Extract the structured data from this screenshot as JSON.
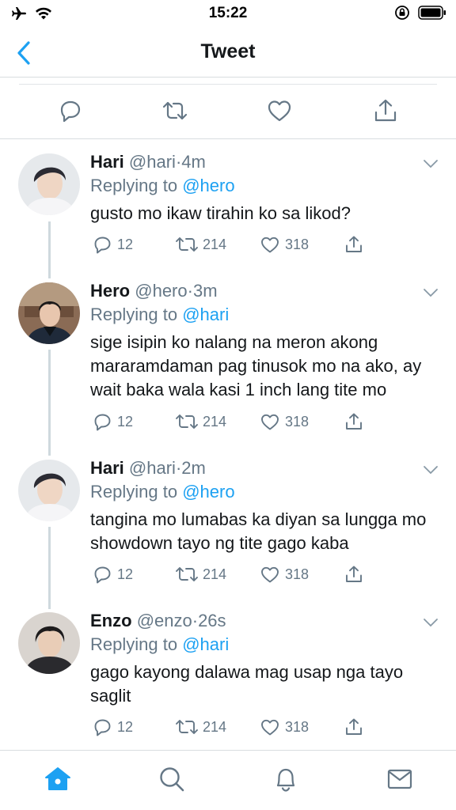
{
  "status": {
    "time": "15:22"
  },
  "nav": {
    "title": "Tweet"
  },
  "tweets": [
    {
      "name": "Hari",
      "handle": "@hari",
      "time": "4m",
      "replying_prefix": "Replying to",
      "replying_to": "@hero",
      "text": "gusto mo ikaw tirahin ko sa likod?",
      "replies": "12",
      "retweets": "214",
      "likes": "318"
    },
    {
      "name": "Hero",
      "handle": "@hero",
      "time": "3m",
      "replying_prefix": "Replying to",
      "replying_to": "@hari",
      "text": "sige isipin ko nalang na meron akong mararamdaman pag tinusok mo na ako, ay wait baka wala kasi 1 inch lang tite mo",
      "replies": "12",
      "retweets": "214",
      "likes": "318"
    },
    {
      "name": "Hari",
      "handle": "@hari",
      "time": "2m",
      "replying_prefix": "Replying to",
      "replying_to": "@hero",
      "text": "tangina mo lumabas ka diyan sa lungga mo showdown tayo ng tite gago kaba",
      "replies": "12",
      "retweets": "214",
      "likes": "318"
    },
    {
      "name": "Enzo",
      "handle": "@enzo",
      "time": "26s",
      "replying_prefix": "Replying to",
      "replying_to": "@hari",
      "text": "gago kayong dalawa mag usap nga tayo saglit",
      "replies": "12",
      "retweets": "214",
      "likes": "318"
    }
  ],
  "colors": {
    "accent": "#1da1f2",
    "secondary_text": "#657786",
    "primary_text": "#14171a"
  },
  "icons": {
    "status": [
      "airplane-icon",
      "wifi-icon",
      "rotation-lock-icon",
      "battery-icon"
    ],
    "nav": [
      "back-chevron-icon"
    ],
    "actions": [
      "reply-icon",
      "retweet-icon",
      "like-icon",
      "share-icon"
    ],
    "tabs": [
      "home-icon",
      "search-icon",
      "notifications-icon",
      "messages-icon"
    ]
  }
}
